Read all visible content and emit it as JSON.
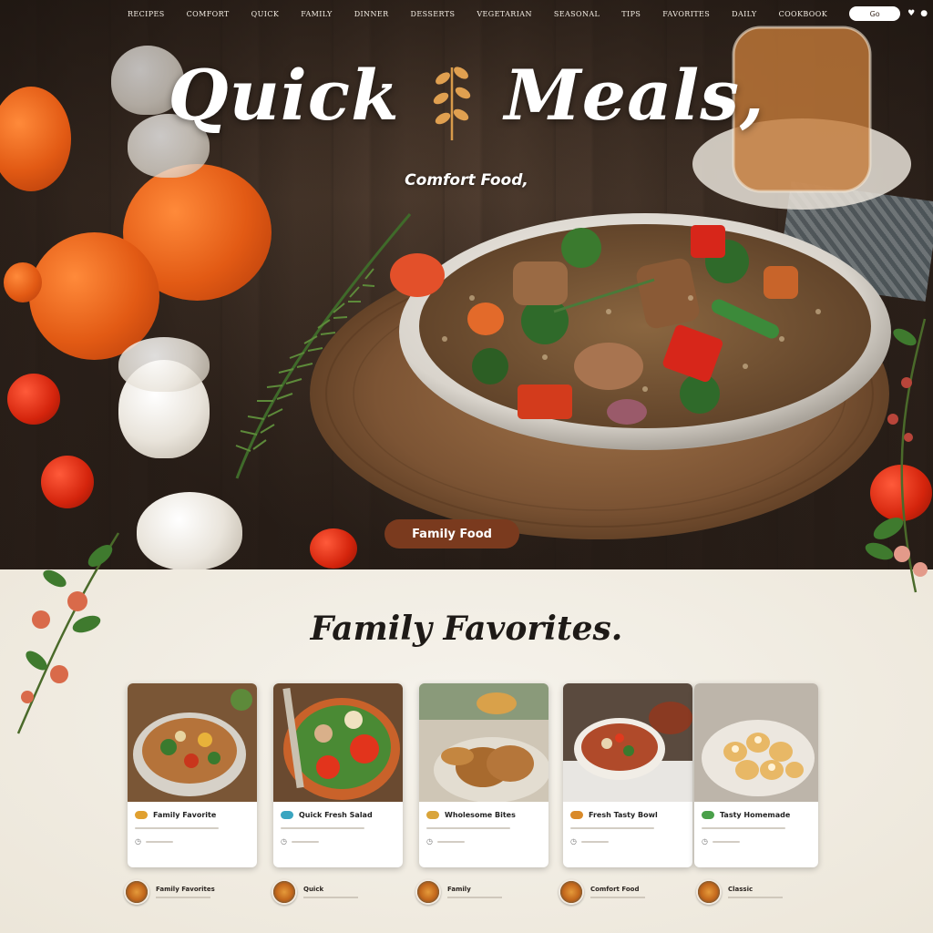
{
  "nav": {
    "items": [
      "Recipes",
      "Comfort",
      "Quick",
      "Family",
      "Dinner",
      "Desserts",
      "Vegetarian",
      "Seasonal",
      "Tips",
      "Favorites",
      "Daily",
      "Cookbook"
    ],
    "pill_label": "Go",
    "icon": "heart-icon"
  },
  "hero": {
    "title_left": "Quick",
    "title_right": "Meals,",
    "subtitle": "Comfort Food,",
    "badge": "Family Food"
  },
  "favorites": {
    "title": "Family Favorites.",
    "cards": [
      {
        "title": "Family Favorite",
        "accent": "#e0a030"
      },
      {
        "title": "Quick Fresh Salad",
        "accent": "#3aa5c0"
      },
      {
        "title": "Wholesome Bites",
        "accent": "#d9a43a"
      },
      {
        "title": "Fresh Tasty Bowl",
        "accent": "#d98a2a"
      },
      {
        "title": "Tasty Homemade",
        "accent": "#4aa04a"
      }
    ],
    "bottom": [
      {
        "name": "Family Favorites"
      },
      {
        "name": "Quick"
      },
      {
        "name": "Family"
      },
      {
        "name": "Comfort Food"
      },
      {
        "name": "Classic"
      }
    ]
  },
  "colors": {
    "badge": "#7a3a1e",
    "hero_dark": "#3e2f24",
    "section_bg": "#efe9dd"
  }
}
